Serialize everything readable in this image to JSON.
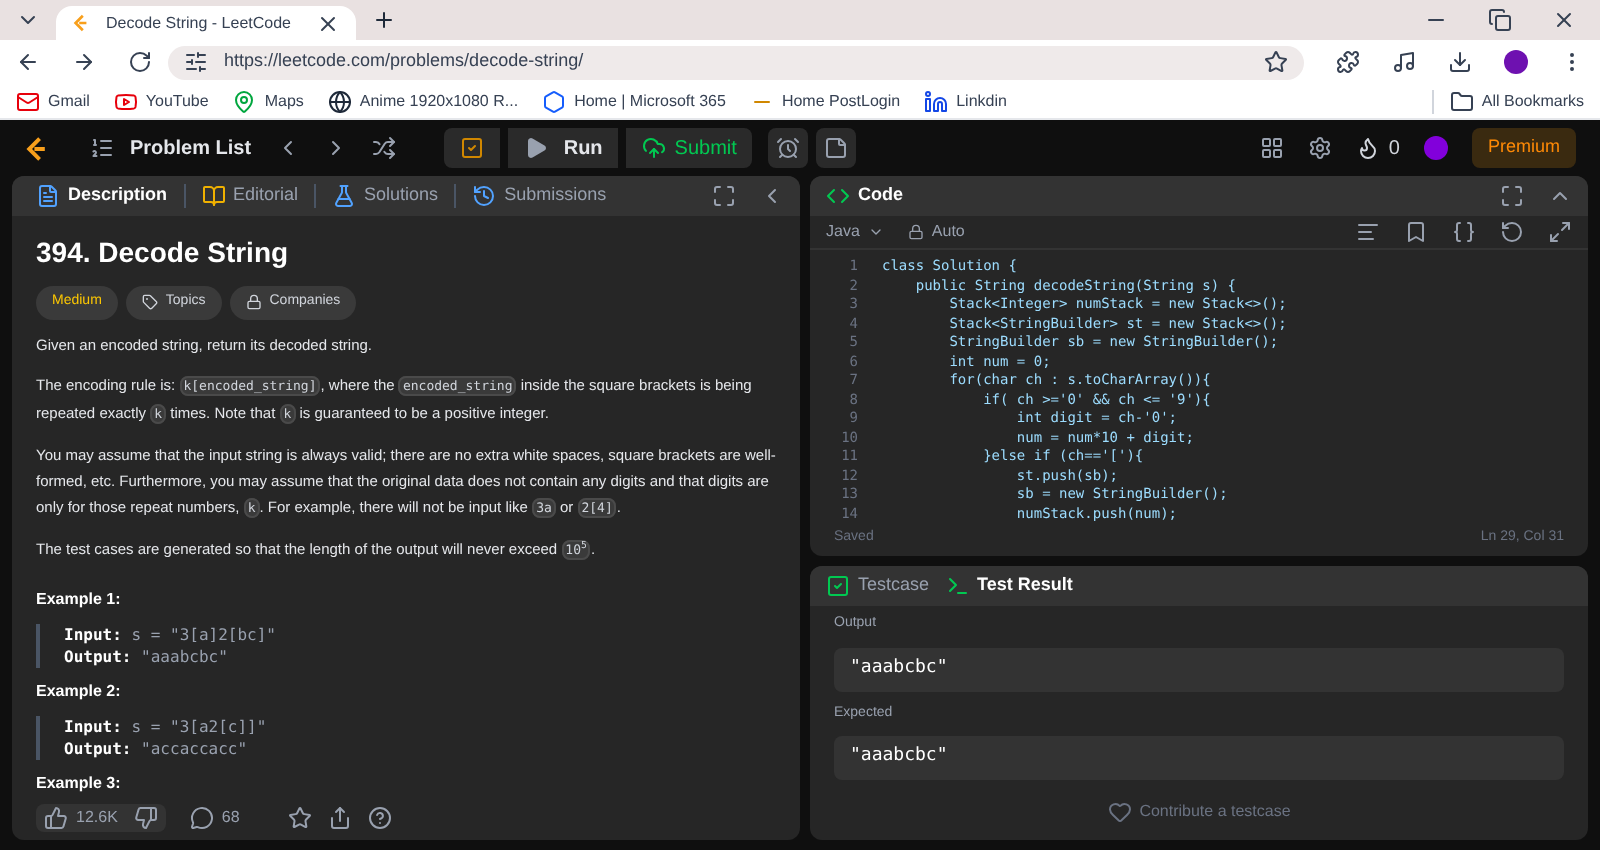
{
  "browser": {
    "tab_title": "Decode String - LeetCode",
    "url": "https://leetcode.com/problems/decode-string/",
    "bookmarks": [
      {
        "label": "Gmail",
        "kind": "mail"
      },
      {
        "label": "YouTube",
        "kind": "video"
      },
      {
        "label": "Maps",
        "kind": "pin"
      },
      {
        "label": "Anime 1920x1080 R...",
        "kind": "globe"
      },
      {
        "label": "Home | Microsoft 365",
        "kind": "office"
      },
      {
        "label": "Home PostLogin",
        "kind": "bar"
      },
      {
        "label": "Linkdin",
        "kind": "in"
      }
    ],
    "all_bookmarks": "All Bookmarks"
  },
  "navbar": {
    "problem_list": "Problem List",
    "run": "Run",
    "submit": "Submit",
    "streak": "0",
    "premium": "Premium"
  },
  "left_tabs": [
    {
      "label": "Description",
      "selected": true
    },
    {
      "label": "Editorial",
      "selected": false
    },
    {
      "label": "Solutions",
      "selected": false
    },
    {
      "label": "Submissions",
      "selected": false
    }
  ],
  "problem": {
    "title": "394. Decode String",
    "difficulty": "Medium",
    "topics": "Topics",
    "companies": "Companies",
    "paragraphs": [
      [
        {
          "kind": "text",
          "text": "Given an encoded string, return its decoded string."
        }
      ],
      [
        {
          "kind": "text",
          "text": "The encoding rule is: "
        },
        {
          "kind": "code",
          "text": "k[encoded_string]"
        },
        {
          "kind": "text",
          "text": ", where the "
        },
        {
          "kind": "code",
          "text": "encoded_string"
        },
        {
          "kind": "text",
          "text": " inside the square brackets is being repeated exactly "
        },
        {
          "kind": "code",
          "text": "k"
        },
        {
          "kind": "text",
          "text": " times. Note that "
        },
        {
          "kind": "code",
          "text": "k"
        },
        {
          "kind": "text",
          "text": " is guaranteed to be a positive integer."
        }
      ],
      [
        {
          "kind": "text",
          "text": "You may assume that the input string is always valid; there are no extra white spaces, square brackets are well-formed, etc. Furthermore, you may assume that the original data does not contain any digits and that digits are only for those repeat numbers, "
        },
        {
          "kind": "code",
          "text": "k"
        },
        {
          "kind": "text",
          "text": ". For example, there will not be input like "
        },
        {
          "kind": "code",
          "text": "3a"
        },
        {
          "kind": "text",
          "text": " or "
        },
        {
          "kind": "code",
          "text": "2[4]"
        },
        {
          "kind": "text",
          "text": "."
        }
      ],
      [
        {
          "kind": "text",
          "text": "The test cases are generated so that the length of the output will never exceed "
        },
        {
          "kind": "code",
          "text": "10$^{5}$"
        },
        {
          "kind": "text",
          "text": "."
        }
      ]
    ],
    "examples": [
      {
        "title": "Example 1:",
        "input_label": "Input:",
        "input": "s = \"3[a]2[bc]\"",
        "output_label": "Output:",
        "output": "\"aaabcbc\""
      },
      {
        "title": "Example 2:",
        "input_label": "Input:",
        "input": "s = \"3[a2[c]]\"",
        "output_label": "Output:",
        "output": "\"accaccacc\""
      },
      {
        "title": "Example 3:"
      }
    ],
    "likes": "12.6K",
    "comments": "68"
  },
  "code_panel": {
    "title": "Code",
    "language": "Java",
    "mode": "Auto",
    "status": "Saved",
    "cursor": "Ln 29, Col 31",
    "lines": [
      {
        "n": "1",
        "code": "class Solution {"
      },
      {
        "n": "2",
        "code": "    public String decodeString(String s) {"
      },
      {
        "n": "3",
        "code": "        Stack<Integer> numStack = new Stack<>();"
      },
      {
        "n": "4",
        "code": "        Stack<StringBuilder> st = new Stack<>();"
      },
      {
        "n": "5",
        "code": "        StringBuilder sb = new StringBuilder();"
      },
      {
        "n": "6",
        "code": "        int num = 0;"
      },
      {
        "n": "7",
        "code": "        for(char ch : s.toCharArray()){"
      },
      {
        "n": "8",
        "code": "            if( ch >='0' && ch <= '9'){"
      },
      {
        "n": "9",
        "code": "                int digit = ch-'0';"
      },
      {
        "n": "10",
        "code": "                num = num*10 + digit;"
      },
      {
        "n": "11",
        "code": "            }else if (ch=='['){"
      },
      {
        "n": "12",
        "code": "                st.push(sb);"
      },
      {
        "n": "13",
        "code": "                sb = new StringBuilder();"
      },
      {
        "n": "14",
        "code": "                numStack.push(num);"
      }
    ]
  },
  "test_panel": {
    "tabs": [
      {
        "label": "Testcase",
        "selected": false
      },
      {
        "label": "Test Result",
        "selected": true
      }
    ],
    "fields": [
      {
        "label": "Output",
        "value": "\"aaabcbc\""
      },
      {
        "label": "Expected",
        "value": "\"aaabcbc\""
      }
    ],
    "contribute": "Contribute a testcase"
  }
}
